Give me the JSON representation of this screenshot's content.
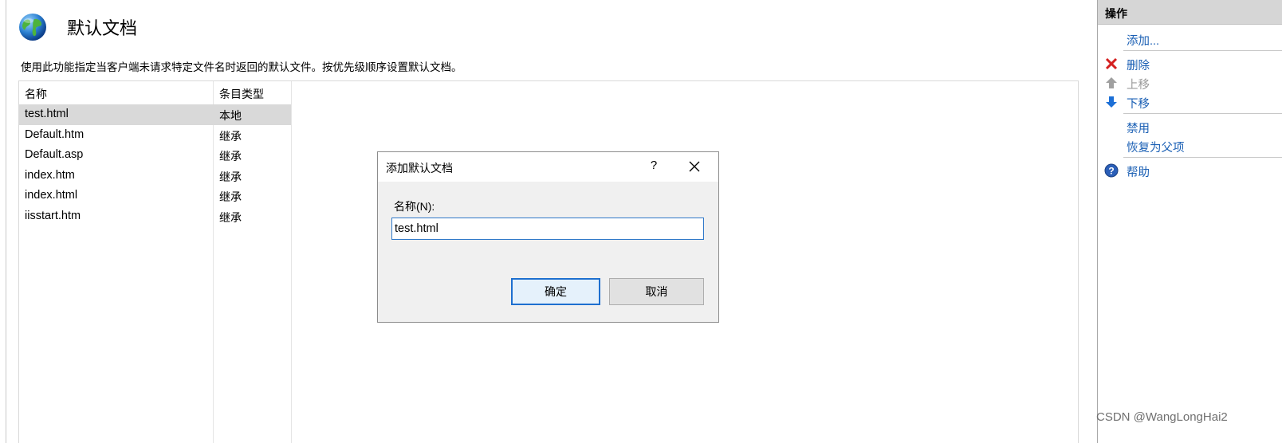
{
  "page": {
    "title": "默认文档",
    "description": "使用此功能指定当客户端未请求特定文件名时返回的默认文件。按优先级顺序设置默认文档。"
  },
  "list": {
    "columns": [
      "名称",
      "条目类型"
    ],
    "rows": [
      {
        "name": "test.html",
        "type": "本地"
      },
      {
        "name": "Default.htm",
        "type": "继承"
      },
      {
        "name": "Default.asp",
        "type": "继承"
      },
      {
        "name": "index.htm",
        "type": "继承"
      },
      {
        "name": "index.html",
        "type": "继承"
      },
      {
        "name": "iisstart.htm",
        "type": "继承"
      }
    ],
    "selected_index": 0
  },
  "dialog": {
    "title": "添加默认文档",
    "help_label": "?",
    "name_label": "名称(N):",
    "name_value": "test.html",
    "ok_label": "确定",
    "cancel_label": "取消"
  },
  "actions": {
    "header": "操作",
    "add": "添加...",
    "remove": "删除",
    "move_up": "上移",
    "move_down": "下移",
    "disable": "禁用",
    "revert": "恢复为父项",
    "help": "帮助"
  },
  "watermark": "CSDN @WangLongHai2",
  "colors": {
    "link": "#1a5fb4",
    "disabled": "#9a9a9a",
    "selected_row": "#d9d9d9",
    "actions_header": "#d6d6d6",
    "focus_border": "#1e6fcf"
  }
}
